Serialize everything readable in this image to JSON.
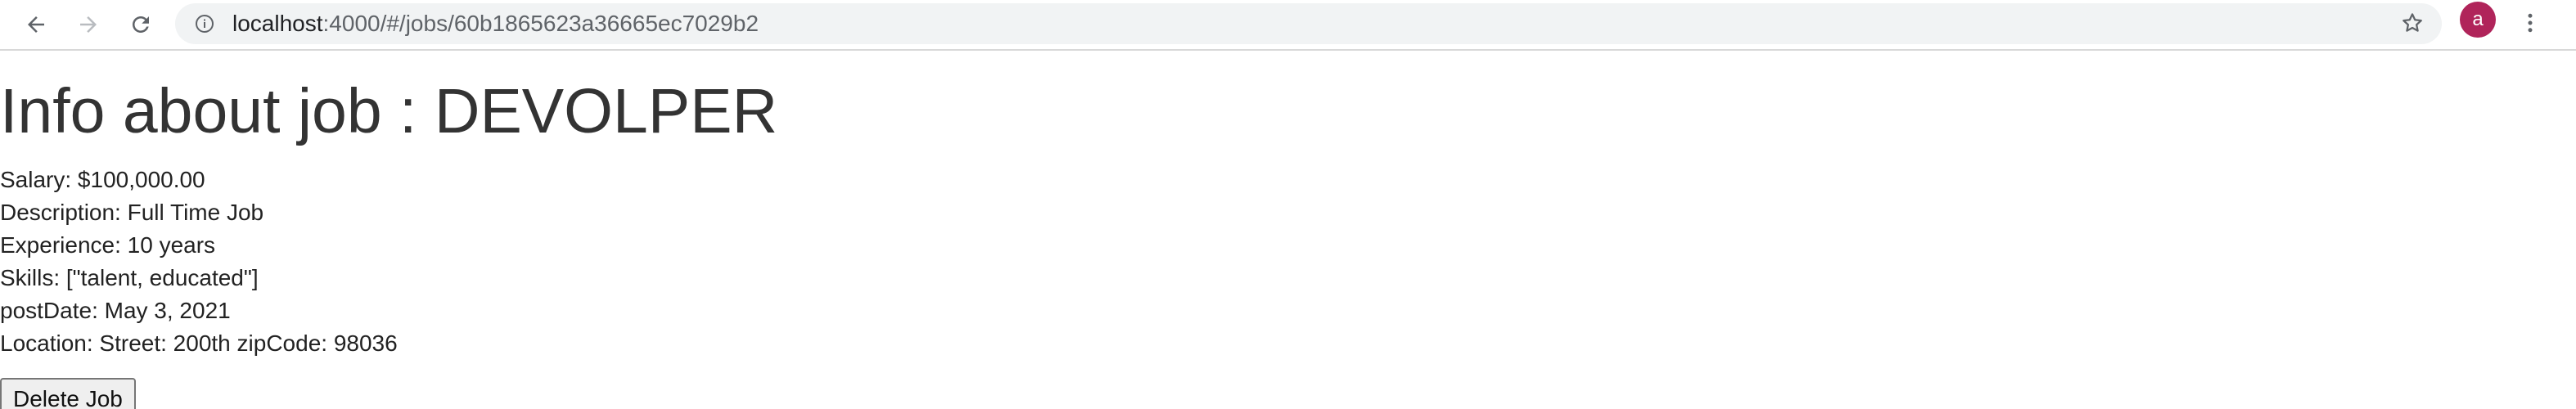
{
  "browser": {
    "url_host": "localhost",
    "url_path": ":4000/#/jobs/60b1865623a36665ec7029b2",
    "avatar_letter": "a",
    "avatar_color": "#b0245a",
    "icons": [
      "back-arrow-icon",
      "forward-arrow-icon",
      "reload-icon",
      "info-icon",
      "star-icon",
      "more-vert-icon"
    ]
  },
  "page": {
    "title": "Info about job : DEVOLPER",
    "details": [
      "Salary: $100,000.00",
      "Description: Full Time Job",
      "Experience: 10 years",
      "Skills: [\"talent, educated\"]",
      "postDate: May 3, 2021",
      "Location: Street: 200th zipCode: 98036"
    ],
    "delete_button": "Delete Job"
  }
}
